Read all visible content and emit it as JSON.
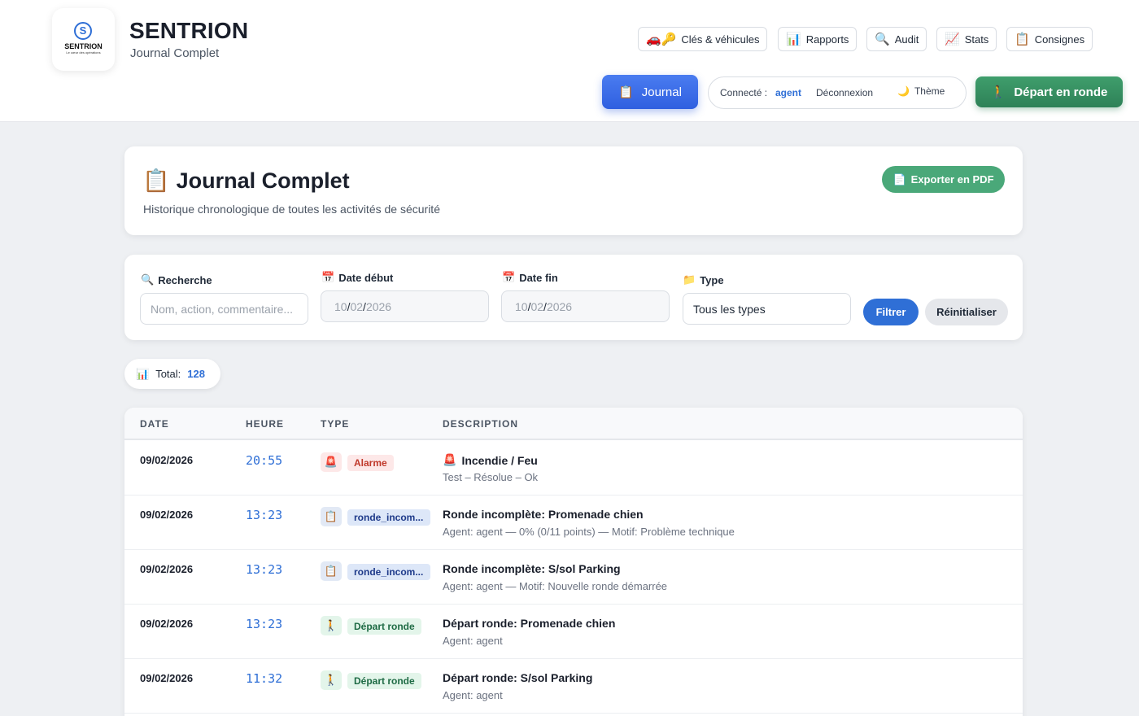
{
  "header": {
    "logo_icon": "s-logo-icon",
    "logo_name": "SENTRION",
    "logo_tagline": "Le cœur des opérations",
    "brand_title": "SENTRION",
    "brand_subtitle": "Journal Complet"
  },
  "nav": [
    {
      "icon": "car-key-icon",
      "glyph": "🚗🔑",
      "label": "Clés & véhicules"
    },
    {
      "icon": "bar-chart-icon",
      "glyph": "📊",
      "label": "Rapports"
    },
    {
      "icon": "magnifier-icon",
      "glyph": "🔍",
      "label": "Audit"
    },
    {
      "icon": "trend-chart-icon",
      "glyph": "📈",
      "label": "Stats"
    },
    {
      "icon": "clipboard-icon",
      "glyph": "📋",
      "label": "Consignes"
    }
  ],
  "toolbar": {
    "journal_glyph": "📋",
    "journal_label": "Journal",
    "connected_label": "Connecté :",
    "connected_user": "agent",
    "logout_label": "Déconnexion",
    "theme_glyph": "🌙",
    "theme_label": "Thème",
    "depart_glyph": "🚶",
    "depart_label": "Départ en ronde"
  },
  "page": {
    "title_glyph": "📋",
    "title": "Journal Complet",
    "description": "Historique chronologique de toutes les activités de sécurité",
    "export_glyph": "📄",
    "export_label": "Exporter en PDF"
  },
  "filters": {
    "search_glyph": "🔍",
    "search_label": "Recherche",
    "search_placeholder": "Nom, action, commentaire...",
    "start_glyph": "📅",
    "start_label": "Date début",
    "start_day": "10",
    "start_month": "02",
    "start_year": "2026",
    "end_glyph": "📅",
    "end_label": "Date fin",
    "end_day": "10",
    "end_month": "02",
    "end_year": "2026",
    "type_glyph": "📁",
    "type_label": "Type",
    "type_value": "Tous les types",
    "filter_button": "Filtrer",
    "reset_button": "Réinitialiser"
  },
  "total": {
    "glyph": "📊",
    "label": "Total:",
    "value": "128"
  },
  "table": {
    "headers": [
      "DATE",
      "HEURE",
      "TYPE",
      "DESCRIPTION"
    ],
    "rows": [
      {
        "date": "09/02/2026",
        "time": "20:55",
        "type_glyph": "🚨",
        "type": "Alarme",
        "desc_glyph": "🚨",
        "description": "Incendie / Feu",
        "detail": "Test – Résolue – Ok"
      },
      {
        "date": "09/02/2026",
        "time": "13:23",
        "type_glyph": "📋",
        "type": "ronde_incom...",
        "desc_glyph": "",
        "description": "Ronde incomplète: Promenade chien",
        "detail": "Agent: agent — 0% (0/11 points) — Motif: Problème technique"
      },
      {
        "date": "09/02/2026",
        "time": "13:23",
        "type_glyph": "📋",
        "type": "ronde_incom...",
        "desc_glyph": "",
        "description": "Ronde incomplète: S/sol Parking",
        "detail": "Agent: agent — Motif: Nouvelle ronde démarrée"
      },
      {
        "date": "09/02/2026",
        "time": "13:23",
        "type_glyph": "🚶",
        "type": "Départ ronde",
        "desc_glyph": "",
        "description": "Départ ronde: Promenade chien",
        "detail": "Agent: agent"
      },
      {
        "date": "09/02/2026",
        "time": "11:32",
        "type_glyph": "🚶",
        "type": "Départ ronde",
        "desc_glyph": "",
        "description": "Départ ronde: S/sol Parking",
        "detail": "Agent: agent"
      }
    ]
  }
}
